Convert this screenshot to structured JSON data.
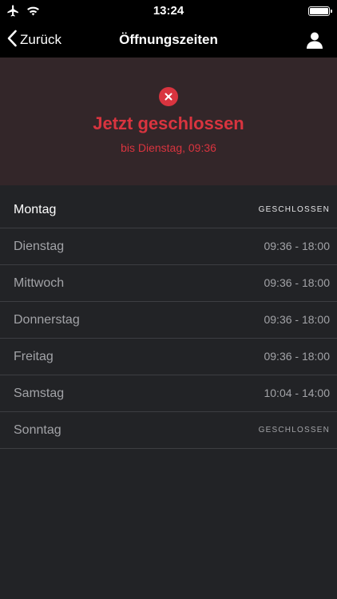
{
  "status_bar": {
    "time": "13:24",
    "battery_level": 1.0
  },
  "nav": {
    "back_label": "Zurück",
    "title": "Öffnungszeiten",
    "profile_icon": "person-icon"
  },
  "banner": {
    "title": "Jetzt geschlossen",
    "subtitle": "bis Dienstag, 09:36",
    "color": "#d9343f"
  },
  "schedule": [
    {
      "day": "Montag",
      "hours": "GESCHLOSSEN",
      "closed": true,
      "current": true
    },
    {
      "day": "Dienstag",
      "hours": "09:36 - 18:00",
      "closed": false,
      "current": false
    },
    {
      "day": "Mittwoch",
      "hours": "09:36 - 18:00",
      "closed": false,
      "current": false
    },
    {
      "day": "Donnerstag",
      "hours": "09:36 - 18:00",
      "closed": false,
      "current": false
    },
    {
      "day": "Freitag",
      "hours": "09:36 - 18:00",
      "closed": false,
      "current": false
    },
    {
      "day": "Samstag",
      "hours": "10:04 - 14:00",
      "closed": false,
      "current": false
    },
    {
      "day": "Sonntag",
      "hours": "GESCHLOSSEN",
      "closed": true,
      "current": false
    }
  ]
}
